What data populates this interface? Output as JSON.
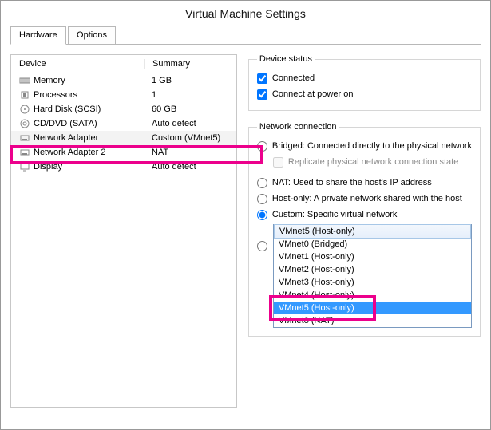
{
  "window": {
    "title": "Virtual Machine Settings"
  },
  "tabs": {
    "hardware": "Hardware",
    "options": "Options"
  },
  "columns": {
    "device": "Device",
    "summary": "Summary"
  },
  "devices": [
    {
      "name": "Memory",
      "summary": "1 GB"
    },
    {
      "name": "Processors",
      "summary": "1"
    },
    {
      "name": "Hard Disk (SCSI)",
      "summary": "60 GB"
    },
    {
      "name": "CD/DVD (SATA)",
      "summary": "Auto detect"
    },
    {
      "name": "Network Adapter",
      "summary": "Custom (VMnet5)"
    },
    {
      "name": "Network Adapter 2",
      "summary": "NAT"
    },
    {
      "name": "Display",
      "summary": "Auto detect"
    }
  ],
  "deviceStatus": {
    "legend": "Device status",
    "connected": "Connected",
    "connectAtPowerOn": "Connect at power on"
  },
  "networkConnection": {
    "legend": "Network connection",
    "bridged": "Bridged: Connected directly to the physical network",
    "replicate": "Replicate physical network connection state",
    "nat": "NAT: Used to share the host's IP address",
    "hostonly": "Host-only: A private network shared with the host",
    "custom": "Custom: Specific virtual network"
  },
  "vmnets": {
    "selectedDefault": "VMnet5 (Host-only)",
    "options": [
      "VMnet0 (Bridged)",
      "VMnet1 (Host-only)",
      "VMnet2 (Host-only)",
      "VMnet3 (Host-only)",
      "VMnet4 (Host-only)",
      "VMnet5 (Host-only)",
      "VMnet8 (NAT)"
    ]
  }
}
